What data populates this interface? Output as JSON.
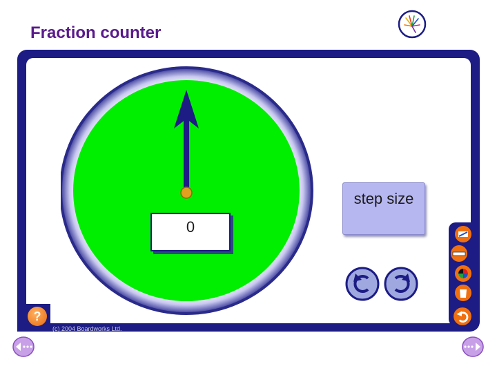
{
  "header": {
    "title": "Fraction counter"
  },
  "counter": {
    "value": "0",
    "pointer_angle_deg": 0
  },
  "controls": {
    "step_size_label": "step size"
  },
  "toolbar": {
    "icons": [
      "pen-icon",
      "eraser-icon",
      "color-wheel-icon",
      "bin-icon",
      "undo-icon"
    ]
  },
  "footer": {
    "help_label": "?",
    "copyright": "(c) 2004 Boardworks Ltd."
  },
  "colors": {
    "frame": "#1c1c84",
    "dial_fill": "#00ee00",
    "accent_orange": "#e86a10",
    "title": "#5a1a8c"
  }
}
